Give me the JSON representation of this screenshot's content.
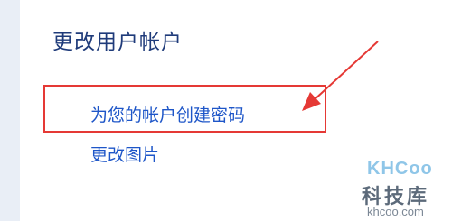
{
  "panel": {
    "heading": "更改用户帐户",
    "links": [
      {
        "label": "为您的帐户创建密码"
      },
      {
        "label": "更改图片"
      }
    ]
  },
  "annotation": {
    "color": "#e53935"
  },
  "watermark": {
    "logo": "KHCoo",
    "name": "科技库",
    "url": "khcoo.com"
  }
}
